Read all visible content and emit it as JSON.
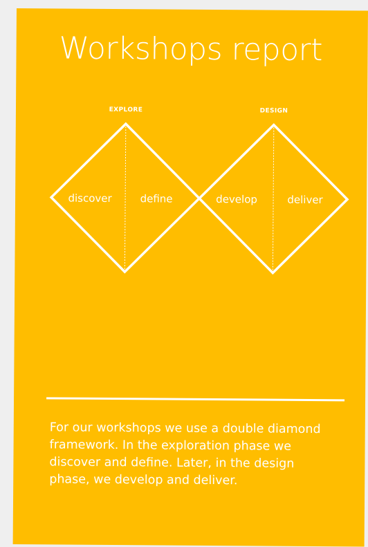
{
  "report": {
    "title": "Workshops report",
    "description": "For our workshops we use a double diamond framework. In the exploration phase we discover and define. Later, in the design phase, we develop and deliver."
  },
  "diagram": {
    "phases": [
      {
        "label": "EXPLORE",
        "stages": [
          "discover",
          "define"
        ]
      },
      {
        "label": "DESIGN",
        "stages": [
          "develop",
          "deliver"
        ]
      }
    ]
  },
  "colors": {
    "card": "#ffbd00",
    "ink": "#ffffff",
    "backdrop": "#efefef"
  }
}
